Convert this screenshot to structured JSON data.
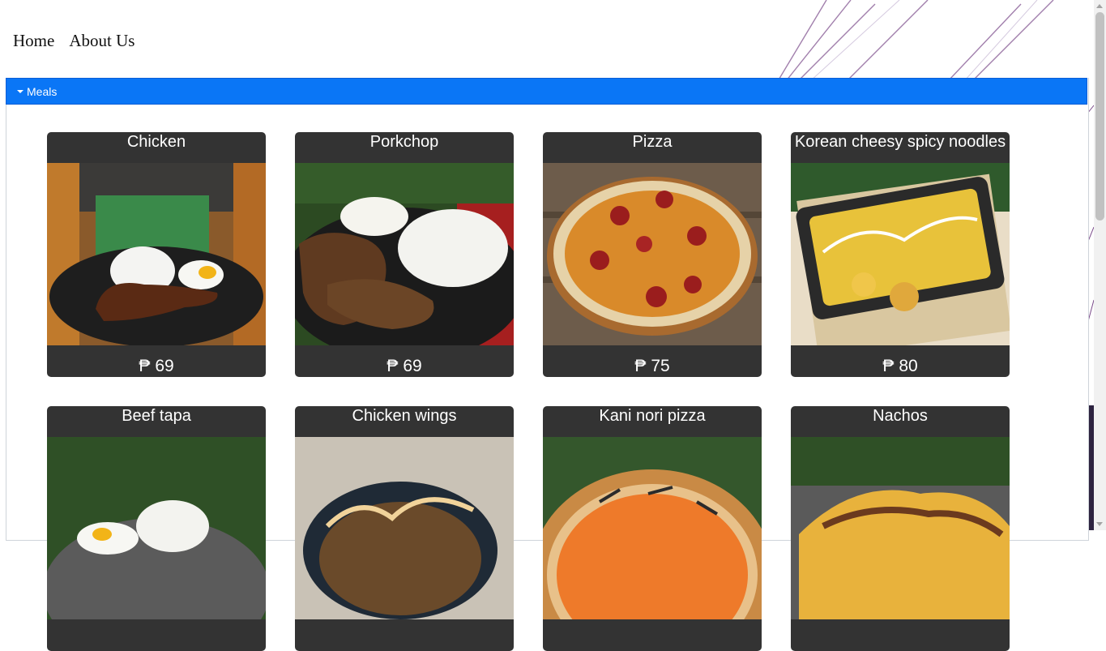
{
  "nav": {
    "home": "Home",
    "about": "About Us"
  },
  "panel": {
    "title": "Meals"
  },
  "currency": "₱",
  "meals": [
    {
      "name": "Chicken",
      "price": "69"
    },
    {
      "name": "Porkchop",
      "price": "69"
    },
    {
      "name": "Pizza",
      "price": "75"
    },
    {
      "name": "Korean cheesy spicy noodles",
      "price": "80"
    },
    {
      "name": "Beef tapa",
      "price": ""
    },
    {
      "name": "Chicken wings",
      "price": ""
    },
    {
      "name": "Kani nori pizza",
      "price": ""
    },
    {
      "name": "Nachos",
      "price": ""
    }
  ],
  "colors": {
    "accent": "#0a76f6",
    "card": "#333333"
  }
}
